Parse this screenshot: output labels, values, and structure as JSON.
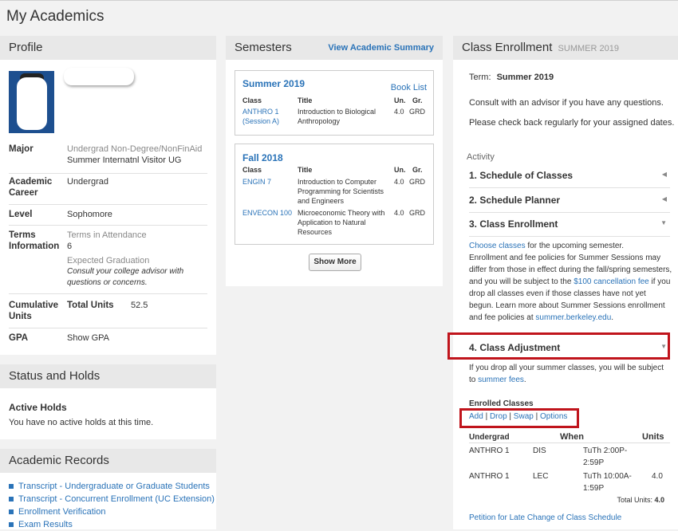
{
  "page_title": "My Academics",
  "profile": {
    "header": "Profile",
    "major_label": "Major",
    "major_line1": "Undergrad Non-Degree/NonFinAid",
    "major_line2": "Summer Internatnl Visitor UG",
    "career_label": "Academic Career",
    "career_value": "Undergrad",
    "level_label": "Level",
    "level_value": "Sophomore",
    "terms_label": "Terms Information",
    "terms_attendance_label": "Terms in Attendance",
    "terms_attendance_value": "6",
    "expected_grad_label": "Expected Graduation",
    "expected_grad_note": "Consult your college advisor with questions or concerns.",
    "cumulative_label": "Cumulative Units",
    "total_units_label": "Total Units",
    "total_units_value": "52.5",
    "gpa_label": "GPA",
    "gpa_link": "Show GPA"
  },
  "status": {
    "header": "Status and Holds",
    "active_holds_title": "Active Holds",
    "active_holds_text": "You have no active holds at this time."
  },
  "records": {
    "header": "Academic Records",
    "links": [
      "Transcript - Undergraduate or Graduate Students",
      "Transcript - Concurrent Enrollment (UC Extension)",
      "Enrollment Verification",
      "Exam Results"
    ]
  },
  "semesters": {
    "header": "Semesters",
    "summary_link": "View Academic Summary",
    "show_more": "Show More",
    "col_class": "Class",
    "col_title": "Title",
    "col_units": "Un.",
    "col_grade": "Gr.",
    "summer": {
      "name": "Summer 2019",
      "book_list": "Book List",
      "rows": [
        {
          "class_line1": "ANTHRO 1",
          "class_line2": "(Session A)",
          "title_line1": "Introduction to Biological",
          "title_line2": "Anthropology",
          "units": "4.0",
          "grade": "GRD"
        }
      ]
    },
    "fall": {
      "name": "Fall 2018",
      "rows": [
        {
          "class": "ENGIN 7",
          "title_line1": "Introduction to Computer",
          "title_line2": "Programming for Scientists",
          "title_line3": "and Engineers",
          "units": "4.0",
          "grade": "GRD"
        },
        {
          "class": "ENVECON 100",
          "title_line1": "Microeconomic Theory with",
          "title_line2": "Application to Natural",
          "title_line3": "Resources",
          "units": "4.0",
          "grade": "GRD"
        }
      ]
    }
  },
  "enrollment": {
    "header": "Class Enrollment",
    "header_term": "SUMMER 2019",
    "term_label": "Term:",
    "term_value": "Summer 2019",
    "advisor_text": "Consult with an advisor if you have any questions.",
    "check_text": "Please check back regularly for your assigned dates.",
    "activity_label": "Activity",
    "steps": [
      "1. Schedule of Classes",
      "2. Schedule Planner",
      "3. Class Enrollment",
      "4. Class Adjustment"
    ],
    "enroll_desc": {
      "link1": "Choose classes",
      "t1": " for the upcoming semester.",
      "l2": "Enrollment and fee policies for Summer Sessions may",
      "l3": "differ from those in effect during the fall/spring semesters,",
      "l4a": "and you will be subject to the ",
      "link2": "$100 cancellation fee",
      "l4b": " if you",
      "l5": "drop all classes even if those classes have not yet",
      "l6": "begun. Learn more about Summer Sessions enrollment",
      "l7a": "and fee policies at ",
      "link3": "summer.berkeley.edu",
      "l7b": "."
    },
    "adjust_desc": {
      "l1": "If you drop all your summer classes, you will be subject",
      "l2a": "to ",
      "link": "summer fees",
      "l2b": "."
    },
    "enrolled_title": "Enrolled Classes",
    "actions": [
      "Add",
      "Drop",
      "Swap",
      "Options"
    ],
    "table_headers": {
      "undergrad": "Undergrad",
      "when": "When",
      "units": "Units"
    },
    "rows": [
      {
        "class": "ANTHRO 1",
        "type": "DIS",
        "when_line1": "TuTh 2:00P-",
        "when_line2": "2:59P",
        "units": ""
      },
      {
        "class": "ANTHRO 1",
        "type": "LEC",
        "when_line1": "TuTh 10:00A-",
        "when_line2": "1:59P",
        "units": "4.0"
      }
    ],
    "total_units_label": "Total Units:",
    "total_units_value": "4.0",
    "petition_link": "Petition for Late Change of Class Schedule"
  },
  "colors": {
    "link": "#2a73b8",
    "highlight": "#c0141c",
    "header_bg": "#e8e8e8"
  }
}
